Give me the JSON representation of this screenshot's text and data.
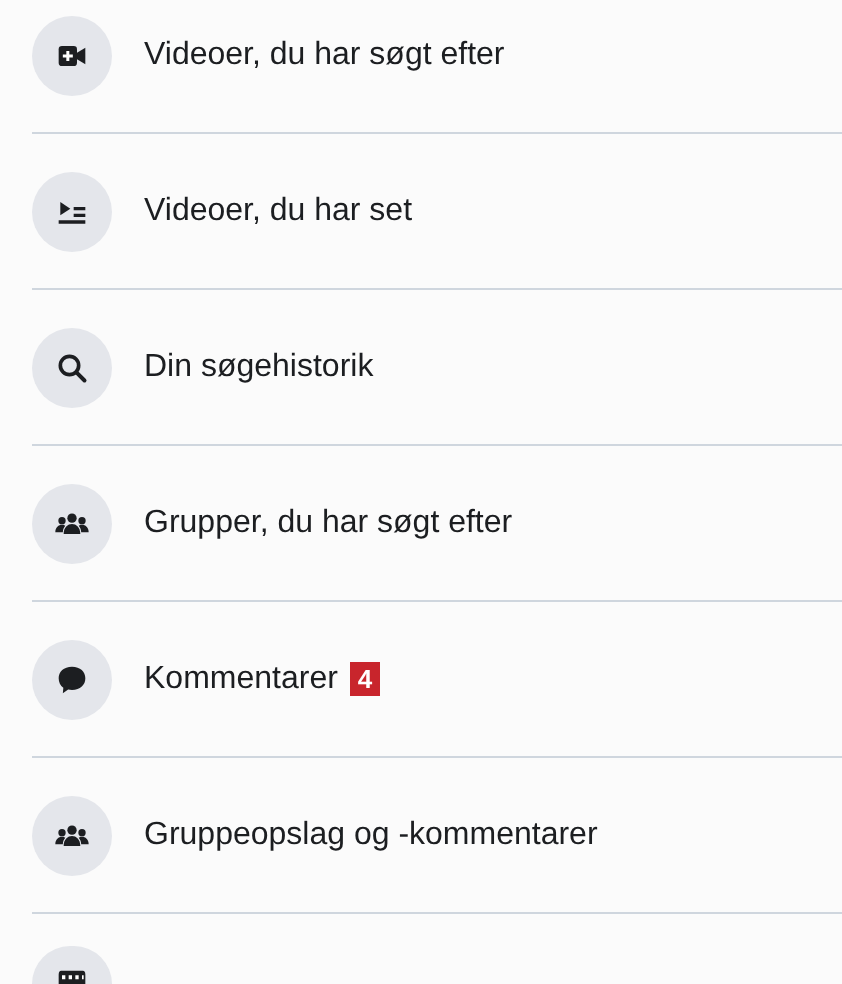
{
  "items": [
    {
      "kind": "entry",
      "label": "Videoer, du har søgt efter"
    },
    {
      "kind": "entry",
      "label": "Videoer, du har set"
    },
    {
      "kind": "entry",
      "label": "Din søgehistorik"
    },
    {
      "kind": "entry",
      "label": "Grupper, du har søgt efter"
    },
    {
      "kind": "entry",
      "label": "Kommentarer",
      "badge": "4"
    },
    {
      "kind": "entry",
      "label": "Gruppeopslag og -kommentarer"
    },
    {
      "kind": "icon_only"
    }
  ]
}
